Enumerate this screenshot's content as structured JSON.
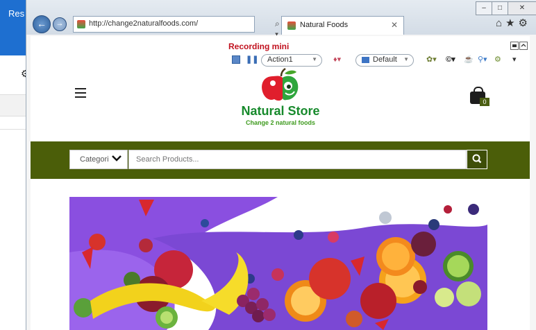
{
  "background_app": {
    "label": "Res"
  },
  "browser": {
    "url": "http://change2naturalfoods.com/",
    "tab_title": "Natural Foods",
    "window_controls": [
      "–",
      "□",
      "✕"
    ],
    "addr_tools": "⌕ ▾ ↻",
    "tab_close": "✕",
    "toolbar_icons": "⌂★⚙"
  },
  "recording": {
    "title": "Recording mini",
    "action_label": "Action1",
    "profile_label": "Default"
  },
  "site": {
    "brand_name": "Natural Store",
    "tagline": "Change 2 natural foods",
    "cart_count": "0"
  },
  "search": {
    "category_label": "Categori",
    "placeholder": "Search Products..."
  },
  "colors": {
    "brand_green": "#178a2c",
    "band_olive": "#4b5e09",
    "banner_purple": "#7a4bd8"
  }
}
